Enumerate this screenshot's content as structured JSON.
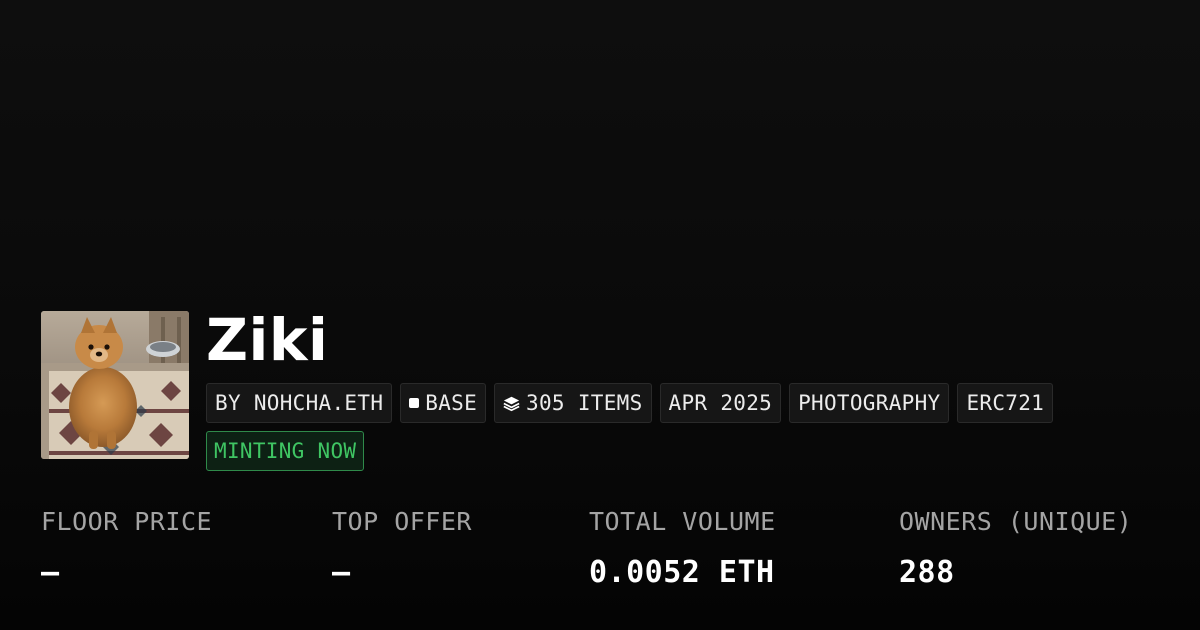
{
  "collection": {
    "name": "Ziki",
    "avatar": {
      "icon": "collection-avatar-pomeranian-photo",
      "alt": "Ziki"
    },
    "tags": [
      {
        "label": "BY NOHCHA.ETH",
        "icon": null
      },
      {
        "label": "BASE",
        "icon": "chain-square-icon"
      },
      {
        "label": "305 ITEMS",
        "icon": "layers-icon"
      },
      {
        "label": "APR 2025",
        "icon": null
      },
      {
        "label": "PHOTOGRAPHY",
        "icon": null
      },
      {
        "label": "ERC721",
        "icon": null
      }
    ],
    "status": {
      "label": "MINTING NOW",
      "color": "#3fc563"
    }
  },
  "stats": [
    {
      "label": "FLOOR PRICE",
      "value": "–"
    },
    {
      "label": "TOP OFFER",
      "value": "–"
    },
    {
      "label": "TOTAL VOLUME",
      "value": "0.0052 ETH"
    },
    {
      "label": "OWNERS (UNIQUE)",
      "value": "288"
    }
  ],
  "colors": {
    "background": "#0a0a0a",
    "tag_background": "#161616",
    "tag_border": "#2a2a2a",
    "label_gray": "#a4a4a4",
    "minting_green": "#3fc563"
  }
}
